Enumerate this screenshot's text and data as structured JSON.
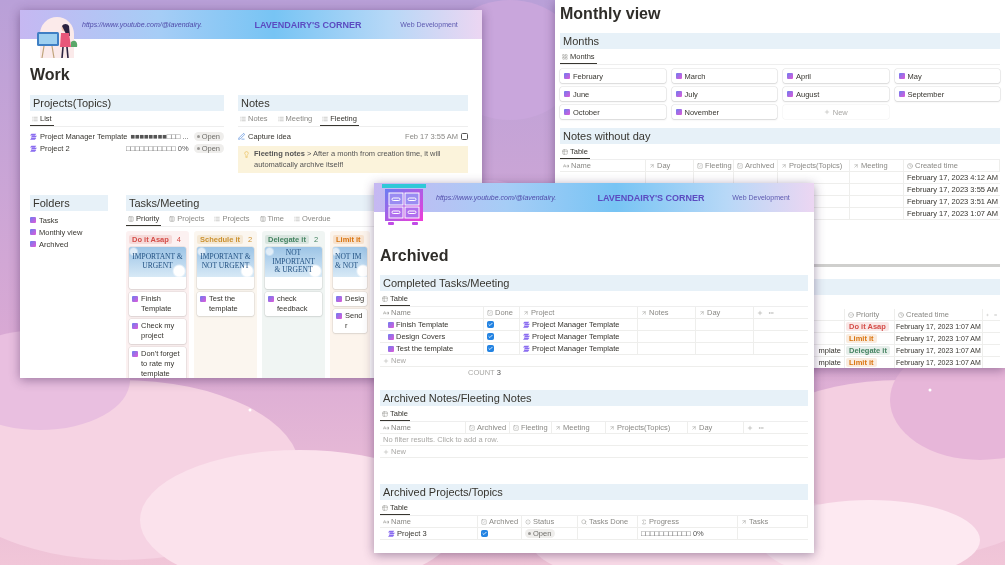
{
  "work_window": {
    "banner": {
      "url": "https://www.youtube.com/@lavendairy.",
      "brand": "LAVENDAIRY'S CORNER",
      "tagline": "Web Development"
    },
    "title": "Work",
    "projects": {
      "heading": "Projects(Topics)",
      "tabs": [
        {
          "label": "List",
          "kind": "list",
          "selected": true
        }
      ],
      "rows": [
        {
          "name": "Project Manager Template",
          "progress": "■■■■■■■■□□□ ...",
          "status": "Open"
        },
        {
          "name": "Project 2",
          "progress": "□□□□□□□□□□□ 0%",
          "status": "Open"
        }
      ]
    },
    "notes": {
      "heading": "Notes",
      "tabs": [
        {
          "label": "Notes",
          "kind": "list",
          "selected": false
        },
        {
          "label": "Meeting",
          "kind": "list",
          "selected": false
        },
        {
          "label": "Fleeting",
          "kind": "list",
          "selected": true
        }
      ],
      "rows": [
        {
          "name": "Capture idea",
          "time": "Feb 17 3:55 AM",
          "checked": false
        }
      ],
      "callout": "**Fleeting notes** >  After a month from creation time, it will automatically archive itself!"
    },
    "folders": {
      "heading": "Folders",
      "items": [
        "Tasks",
        "Monthly view",
        "Archived"
      ]
    },
    "tasks": {
      "heading": "Tasks/Meeting",
      "tabs": [
        {
          "label": "Priority",
          "kind": "board",
          "selected": true
        },
        {
          "label": "Projects",
          "kind": "board",
          "selected": false
        },
        {
          "label": "Projects",
          "kind": "list",
          "selected": false
        },
        {
          "label": "Time",
          "kind": "board",
          "selected": false
        },
        {
          "label": "Overdue",
          "kind": "list",
          "selected": false
        }
      ],
      "columns": [
        {
          "tag": "Do it Asap",
          "count": "4",
          "color": "#d44c47",
          "cover": "IMPORTANT &\nURGENT",
          "cards": [
            "Finish Template",
            "Check my project",
            "Don't forget to rate my template"
          ]
        },
        {
          "tag": "Schedule it",
          "count": "2",
          "color": "#cb912f",
          "cover": "IMPORTANT &\nNOT URGENT",
          "cards": [
            "Test the template"
          ]
        },
        {
          "tag": "Delegate it",
          "count": "2",
          "color": "#448361",
          "cover": "NOT IMPORTANT\n& URGENT",
          "cards": [
            "check feedback"
          ]
        },
        {
          "tag": "Limit it",
          "color": "#d9730d",
          "cover": "NOT IM\n& NOT",
          "cards": [
            "Desig",
            "Send r"
          ]
        }
      ]
    }
  },
  "monthly_window": {
    "title": "Monthly view",
    "months": {
      "heading": "Months",
      "tabs": [
        {
          "label": "Months",
          "kind": "gallery",
          "selected": true
        }
      ],
      "items": [
        "February",
        "March",
        "April",
        "May",
        "June",
        "July",
        "August",
        "September",
        "October",
        "November"
      ],
      "new_label": "New"
    },
    "notes": {
      "heading": "Notes without day",
      "tabs": [
        {
          "label": "Table",
          "kind": "table",
          "selected": true
        }
      ],
      "columns": [
        {
          "label": "Name",
          "kind": "text"
        },
        {
          "label": "Day",
          "kind": "relation"
        },
        {
          "label": "Fleeting",
          "kind": "checkbox"
        },
        {
          "label": "Archived",
          "kind": "checkbox"
        },
        {
          "label": "Projects(Topics)",
          "kind": "relation"
        },
        {
          "label": "Meeting",
          "kind": "relation"
        },
        {
          "label": "Created time",
          "kind": "clock"
        }
      ],
      "rows": [
        "February 17, 2023 4:12 AM",
        "February 17, 2023 3:55 AM",
        "February 17, 2023 3:51 AM",
        "February 17, 2023 1:07 AM"
      ]
    },
    "tasks": {
      "columns": [
        {
          "label": "Priority",
          "kind": "select"
        },
        {
          "label": "Created time",
          "kind": "clock"
        }
      ],
      "rows": [
        {
          "priority": "Do it Asap",
          "color": "#d44c47",
          "created": "February 17, 2023 1:07 AM"
        },
        {
          "priority": "Limit it",
          "color": "#d9730d",
          "created": "February 17, 2023 1:07 AM"
        },
        {
          "project": "mplate",
          "priority": "Delegate it",
          "color": "#448361",
          "created": "February 17, 2023 1:07 AM"
        },
        {
          "project": "mplate",
          "priority": "Limit it",
          "color": "#d9730d",
          "created": "February 17, 2023 1:07 AM"
        }
      ]
    }
  },
  "archived_window": {
    "banner": {
      "url": "https://www.youtube.com/@lavendairy.",
      "brand": "LAVENDAIRY'S CORNER",
      "tagline": "Web Development"
    },
    "title": "Archived",
    "completed": {
      "heading": "Completed Tasks/Meeting",
      "tabs": [
        {
          "label": "Table",
          "kind": "table",
          "selected": true
        }
      ],
      "columns": [
        {
          "label": "Name",
          "kind": "text"
        },
        {
          "label": "Done",
          "kind": "checkbox"
        },
        {
          "label": "Project",
          "kind": "relation"
        },
        {
          "label": "Notes",
          "kind": "relation"
        },
        {
          "label": "Day",
          "kind": "relation"
        }
      ],
      "rows": [
        {
          "name": "Finish Template",
          "done": true,
          "project": "Project Manager Template"
        },
        {
          "name": "Design Covers",
          "done": true,
          "project": "Project Manager Template"
        },
        {
          "name": "Test the template",
          "done": true,
          "project": "Project Manager Template"
        }
      ],
      "new_label": "New",
      "count_label": "COUNT",
      "count": "3"
    },
    "notes": {
      "heading": "Archived Notes/Fleeting Notes",
      "tabs": [
        {
          "label": "Table",
          "kind": "table",
          "selected": true
        }
      ],
      "columns": [
        {
          "label": "Name",
          "kind": "text"
        },
        {
          "label": "Archived",
          "kind": "checkbox"
        },
        {
          "label": "Fleeting",
          "kind": "checkbox"
        },
        {
          "label": "Meeting",
          "kind": "relation"
        },
        {
          "label": "Projects(Topics)",
          "kind": "relation"
        },
        {
          "label": "Day",
          "kind": "relation"
        }
      ],
      "empty": "No filter results. Click to add a row.",
      "new_label": "New"
    },
    "projects": {
      "heading": "Archived Projects/Topics",
      "tabs": [
        {
          "label": "Table",
          "kind": "table",
          "selected": true
        }
      ],
      "columns": [
        {
          "label": "Name",
          "kind": "text"
        },
        {
          "label": "Archived",
          "kind": "checkbox"
        },
        {
          "label": "Status",
          "kind": "status"
        },
        {
          "label": "Tasks Done",
          "kind": "search"
        },
        {
          "label": "Progress",
          "kind": "formula"
        },
        {
          "label": "Tasks",
          "kind": "relation"
        }
      ],
      "rows": [
        {
          "name": "Project 3",
          "archived": true,
          "status": "Open",
          "progress": "□□□□□□□□□□□ 0%"
        }
      ]
    }
  }
}
